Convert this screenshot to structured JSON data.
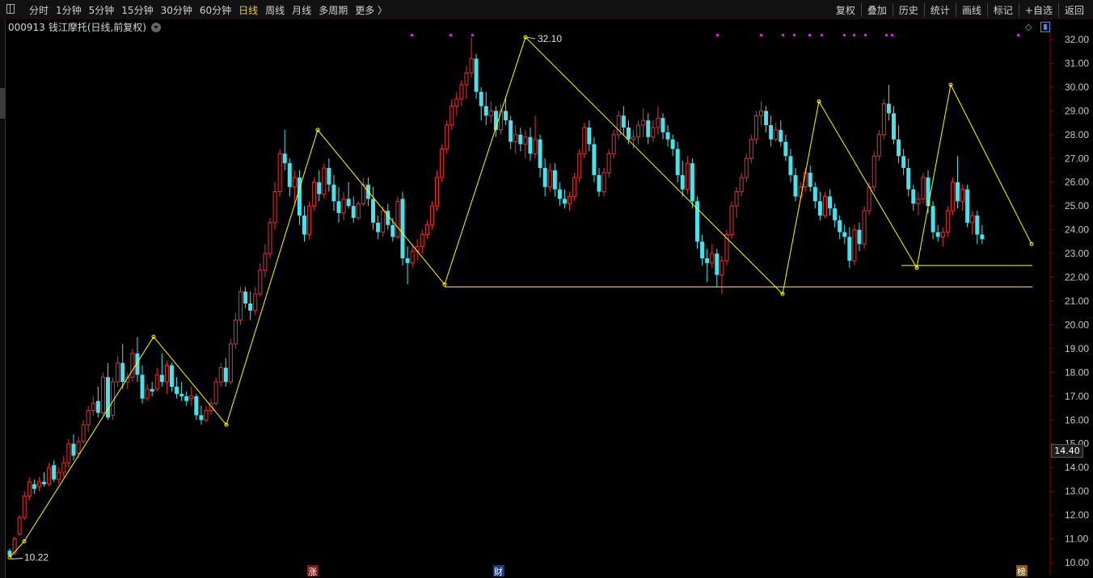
{
  "toolbar": {
    "tabs": [
      "分时",
      "1分钟",
      "5分钟",
      "15分钟",
      "30分钟",
      "60分钟",
      "日线",
      "周线",
      "月线",
      "多周期",
      "更多 〉"
    ],
    "active_tab": "日线",
    "tools": [
      "复权",
      "叠加",
      "历史",
      "统计",
      "画线",
      "标记",
      "+自选",
      "返回"
    ]
  },
  "header": {
    "code": "000913",
    "name": "钱江摩托(日线,前复权)",
    "corner_diamond": "◇"
  },
  "current_price": "14.40",
  "colors": {
    "up": "#e83232",
    "down": "#4ee0e8",
    "zigzag": "#ffff00",
    "axis_text": "#c8c8c8",
    "marker": "#e020e0",
    "bg": "#000000"
  },
  "chart_data": {
    "type": "candlestick",
    "title": "",
    "ylim": [
      9.6,
      32.4
    ],
    "y_ticks": [
      10,
      11,
      12,
      13,
      14,
      15,
      16,
      17,
      18,
      19,
      20,
      21,
      22,
      23,
      24,
      25,
      26,
      27,
      28,
      29,
      30,
      31,
      32
    ],
    "high_label": "32.10",
    "low_label": "10.22",
    "zigzag": [
      10.22,
      10.9,
      19.5,
      15.8,
      28.2,
      21.7,
      32.1,
      21.3,
      29.4,
      22.4,
      30.1,
      23.4
    ],
    "support_lines": [
      21.6,
      22.5
    ],
    "ohlc": [
      [
        10.5,
        10.6,
        10.22,
        10.3
      ],
      [
        10.4,
        11.1,
        10.3,
        11.0
      ],
      [
        11.2,
        12.0,
        11.1,
        11.9
      ],
      [
        11.9,
        13.0,
        11.8,
        12.8
      ],
      [
        12.8,
        13.6,
        12.6,
        13.4
      ],
      [
        13.3,
        13.5,
        12.9,
        13.1
      ],
      [
        13.2,
        13.6,
        13.0,
        13.4
      ],
      [
        13.4,
        13.8,
        13.2,
        13.3
      ],
      [
        13.3,
        14.2,
        13.2,
        14.0
      ],
      [
        14.1,
        14.3,
        13.4,
        13.5
      ],
      [
        13.5,
        14.0,
        13.3,
        13.8
      ],
      [
        13.8,
        14.5,
        13.6,
        14.2
      ],
      [
        14.2,
        15.2,
        14.0,
        15.0
      ],
      [
        15.0,
        15.4,
        14.3,
        14.5
      ],
      [
        14.6,
        15.3,
        14.4,
        15.1
      ],
      [
        15.1,
        16.0,
        15.0,
        15.8
      ],
      [
        15.8,
        16.6,
        15.5,
        16.4
      ],
      [
        16.4,
        17.0,
        16.2,
        16.7
      ],
      [
        16.8,
        17.4,
        16.1,
        16.3
      ],
      [
        16.3,
        18.0,
        16.2,
        17.8
      ],
      [
        17.8,
        18.4,
        16.0,
        16.1
      ],
      [
        16.2,
        17.8,
        16.0,
        17.6
      ],
      [
        17.6,
        18.7,
        17.4,
        18.4
      ],
      [
        18.4,
        19.2,
        17.3,
        17.6
      ],
      [
        17.6,
        18.0,
        17.3,
        17.8
      ],
      [
        17.8,
        19.0,
        17.6,
        18.8
      ],
      [
        18.8,
        19.5,
        17.6,
        17.9
      ],
      [
        17.9,
        18.3,
        16.7,
        16.9
      ],
      [
        16.9,
        17.5,
        16.8,
        17.3
      ],
      [
        17.3,
        17.6,
        17.0,
        17.2
      ],
      [
        17.3,
        18.2,
        17.2,
        17.9
      ],
      [
        17.9,
        18.8,
        17.4,
        17.6
      ],
      [
        17.6,
        18.5,
        17.1,
        18.3
      ],
      [
        18.3,
        18.4,
        17.2,
        17.4
      ],
      [
        17.4,
        17.8,
        16.9,
        17.1
      ],
      [
        17.1,
        17.6,
        16.8,
        17.0
      ],
      [
        17.0,
        17.2,
        16.6,
        16.8
      ],
      [
        16.9,
        17.4,
        16.6,
        17.0
      ],
      [
        17.0,
        17.1,
        16.0,
        16.2
      ],
      [
        16.2,
        16.6,
        15.8,
        16.0
      ],
      [
        16.0,
        16.6,
        15.9,
        16.4
      ],
      [
        16.4,
        16.9,
        16.2,
        16.7
      ],
      [
        16.7,
        17.8,
        16.6,
        17.6
      ],
      [
        17.6,
        18.4,
        17.4,
        18.2
      ],
      [
        18.2,
        18.6,
        17.4,
        17.6
      ],
      [
        17.6,
        19.4,
        17.5,
        19.2
      ],
      [
        19.2,
        20.5,
        19.0,
        20.2
      ],
      [
        20.2,
        21.6,
        20.0,
        21.4
      ],
      [
        21.4,
        21.6,
        20.7,
        20.9
      ],
      [
        20.9,
        21.4,
        20.2,
        20.6
      ],
      [
        20.6,
        21.6,
        20.4,
        21.3
      ],
      [
        21.3,
        22.6,
        21.2,
        22.3
      ],
      [
        22.3,
        23.4,
        22.0,
        23.0
      ],
      [
        23.0,
        24.5,
        22.8,
        24.3
      ],
      [
        24.3,
        26.0,
        24.0,
        25.6
      ],
      [
        25.6,
        27.4,
        25.4,
        27.2
      ],
      [
        27.2,
        28.2,
        26.5,
        26.8
      ],
      [
        26.8,
        27.0,
        25.4,
        25.8
      ],
      [
        25.8,
        26.5,
        25.0,
        26.2
      ],
      [
        26.2,
        26.5,
        24.2,
        24.6
      ],
      [
        24.6,
        25.0,
        23.5,
        23.8
      ],
      [
        23.8,
        25.2,
        23.6,
        25.0
      ],
      [
        25.0,
        26.2,
        24.8,
        26.0
      ],
      [
        26.0,
        26.5,
        25.2,
        25.5
      ],
      [
        25.5,
        26.8,
        25.3,
        26.6
      ],
      [
        26.6,
        27.0,
        25.6,
        25.9
      ],
      [
        25.9,
        26.3,
        24.8,
        25.2
      ],
      [
        25.2,
        25.8,
        24.3,
        24.7
      ],
      [
        24.7,
        25.6,
        24.4,
        25.3
      ],
      [
        25.3,
        26.0,
        24.9,
        25.0
      ],
      [
        25.0,
        25.4,
        24.3,
        24.5
      ],
      [
        24.5,
        25.2,
        24.4,
        25.1
      ],
      [
        25.1,
        26.2,
        25.0,
        25.9
      ],
      [
        25.9,
        26.2,
        25.0,
        25.3
      ],
      [
        25.3,
        25.8,
        24.0,
        24.3
      ],
      [
        24.3,
        24.6,
        23.6,
        23.9
      ],
      [
        23.9,
        25.0,
        23.7,
        24.8
      ],
      [
        24.8,
        25.1,
        24.0,
        24.2
      ],
      [
        24.2,
        24.5,
        23.5,
        23.7
      ],
      [
        23.7,
        25.4,
        23.6,
        25.2
      ],
      [
        25.3,
        25.6,
        22.5,
        22.8
      ],
      [
        22.8,
        23.3,
        21.7,
        22.6
      ],
      [
        22.6,
        23.4,
        22.4,
        23.1
      ],
      [
        23.1,
        23.6,
        22.7,
        23.3
      ],
      [
        23.3,
        24.0,
        23.0,
        23.8
      ],
      [
        23.8,
        24.4,
        23.6,
        24.2
      ],
      [
        24.2,
        25.2,
        24.0,
        25.0
      ],
      [
        25.0,
        26.5,
        24.8,
        26.2
      ],
      [
        26.2,
        27.6,
        26.0,
        27.4
      ],
      [
        27.4,
        28.6,
        27.2,
        28.4
      ],
      [
        28.4,
        29.5,
        28.2,
        29.2
      ],
      [
        29.2,
        29.8,
        28.8,
        29.5
      ],
      [
        29.5,
        30.3,
        29.2,
        30.1
      ],
      [
        30.1,
        30.9,
        29.5,
        30.6
      ],
      [
        30.6,
        32.1,
        30.4,
        31.2
      ],
      [
        31.2,
        31.4,
        29.5,
        29.8
      ],
      [
        29.8,
        30.0,
        28.6,
        29.2
      ],
      [
        29.2,
        29.8,
        28.4,
        28.8
      ],
      [
        28.8,
        29.4,
        28.5,
        29.0
      ],
      [
        29.0,
        29.2,
        27.9,
        28.2
      ],
      [
        28.2,
        29.3,
        28.0,
        29.0
      ],
      [
        29.0,
        29.6,
        28.4,
        28.6
      ],
      [
        28.6,
        28.8,
        27.4,
        27.7
      ],
      [
        27.7,
        28.4,
        27.2,
        28.0
      ],
      [
        28.0,
        28.3,
        27.3,
        27.6
      ],
      [
        27.6,
        28.2,
        27.0,
        27.9
      ],
      [
        27.9,
        28.3,
        26.9,
        27.2
      ],
      [
        27.2,
        28.8,
        27.0,
        27.8
      ],
      [
        27.8,
        28.0,
        26.2,
        26.6
      ],
      [
        26.6,
        27.0,
        25.4,
        25.8
      ],
      [
        25.8,
        26.8,
        25.6,
        26.5
      ],
      [
        26.5,
        26.8,
        25.4,
        25.7
      ],
      [
        25.7,
        26.0,
        25.0,
        25.3
      ],
      [
        25.3,
        25.7,
        24.9,
        25.1
      ],
      [
        25.1,
        25.6,
        24.8,
        25.4
      ],
      [
        25.4,
        26.4,
        25.2,
        26.2
      ],
      [
        26.2,
        27.4,
        26.0,
        27.2
      ],
      [
        27.2,
        28.5,
        27.0,
        28.3
      ],
      [
        28.3,
        28.6,
        27.3,
        27.6
      ],
      [
        27.6,
        27.9,
        26.0,
        26.3
      ],
      [
        26.3,
        26.6,
        25.4,
        25.6
      ],
      [
        25.6,
        26.6,
        25.4,
        26.4
      ],
      [
        26.4,
        27.4,
        26.2,
        27.2
      ],
      [
        27.2,
        28.2,
        27.0,
        28.0
      ],
      [
        28.0,
        29.0,
        27.8,
        28.8
      ],
      [
        28.8,
        29.2,
        28.0,
        28.3
      ],
      [
        28.3,
        28.6,
        27.6,
        27.8
      ],
      [
        27.8,
        28.2,
        27.4,
        27.9
      ],
      [
        27.9,
        28.6,
        27.6,
        28.4
      ],
      [
        28.4,
        29.1,
        27.9,
        28.6
      ],
      [
        28.6,
        28.9,
        27.6,
        27.9
      ],
      [
        27.9,
        28.6,
        27.7,
        28.3
      ],
      [
        28.3,
        29.2,
        28.0,
        28.7
      ],
      [
        28.7,
        28.9,
        27.8,
        28.1
      ],
      [
        28.1,
        28.4,
        27.5,
        27.8
      ],
      [
        27.8,
        28.0,
        27.1,
        27.4
      ],
      [
        27.4,
        27.7,
        26.0,
        26.3
      ],
      [
        26.3,
        26.9,
        25.4,
        25.7
      ],
      [
        25.7,
        27.1,
        25.5,
        26.8
      ],
      [
        26.8,
        27.0,
        24.9,
        25.2
      ],
      [
        25.2,
        25.4,
        23.2,
        23.5
      ],
      [
        23.5,
        23.8,
        22.5,
        22.8
      ],
      [
        22.8,
        23.2,
        21.8,
        22.6
      ],
      [
        22.6,
        23.4,
        22.4,
        23.0
      ],
      [
        23.0,
        23.2,
        21.6,
        22.1
      ],
      [
        22.1,
        22.9,
        21.3,
        22.7
      ],
      [
        22.7,
        24.0,
        22.5,
        23.8
      ],
      [
        23.8,
        25.2,
        23.6,
        25.0
      ],
      [
        25.0,
        25.8,
        24.5,
        25.6
      ],
      [
        25.6,
        26.4,
        25.4,
        26.2
      ],
      [
        26.2,
        27.2,
        26.0,
        27.0
      ],
      [
        27.0,
        28.0,
        26.8,
        27.8
      ],
      [
        27.8,
        29.0,
        27.6,
        28.8
      ],
      [
        28.8,
        29.4,
        28.4,
        29.0
      ],
      [
        29.0,
        29.2,
        28.1,
        28.4
      ],
      [
        28.4,
        28.8,
        27.5,
        27.8
      ],
      [
        27.8,
        28.5,
        27.7,
        28.2
      ],
      [
        28.2,
        28.6,
        27.5,
        27.7
      ],
      [
        27.7,
        28.0,
        26.9,
        27.1
      ],
      [
        27.1,
        27.4,
        26.0,
        26.3
      ],
      [
        26.3,
        26.6,
        25.2,
        25.4
      ],
      [
        25.4,
        26.0,
        25.2,
        25.8
      ],
      [
        25.8,
        26.6,
        25.6,
        26.4
      ],
      [
        26.4,
        26.7,
        25.6,
        25.8
      ],
      [
        25.8,
        26.0,
        24.9,
        25.2
      ],
      [
        25.2,
        25.6,
        24.4,
        24.6
      ],
      [
        24.6,
        25.6,
        24.5,
        25.4
      ],
      [
        25.4,
        25.7,
        24.6,
        24.9
      ],
      [
        24.9,
        25.1,
        24.1,
        24.4
      ],
      [
        24.4,
        24.6,
        23.6,
        23.9
      ],
      [
        23.9,
        24.2,
        23.4,
        23.7
      ],
      [
        23.7,
        24.1,
        22.4,
        22.7
      ],
      [
        22.7,
        24.2,
        22.5,
        24.0
      ],
      [
        24.0,
        24.3,
        23.1,
        23.4
      ],
      [
        23.4,
        25.0,
        23.2,
        24.8
      ],
      [
        24.8,
        26.0,
        24.6,
        25.8
      ],
      [
        25.8,
        27.3,
        25.6,
        27.1
      ],
      [
        27.1,
        28.2,
        26.9,
        28.0
      ],
      [
        28.0,
        29.5,
        27.8,
        29.3
      ],
      [
        29.3,
        30.1,
        28.6,
        28.9
      ],
      [
        28.9,
        29.2,
        27.6,
        27.8
      ],
      [
        27.8,
        28.4,
        26.8,
        27.1
      ],
      [
        27.1,
        27.4,
        26.3,
        26.6
      ],
      [
        26.6,
        27.0,
        25.4,
        25.7
      ],
      [
        25.7,
        25.9,
        24.8,
        25.1
      ],
      [
        25.1,
        25.6,
        24.6,
        25.3
      ],
      [
        25.3,
        26.4,
        25.1,
        26.2
      ],
      [
        26.2,
        26.5,
        24.7,
        25.0
      ],
      [
        25.0,
        25.2,
        23.6,
        23.9
      ],
      [
        23.9,
        24.2,
        23.5,
        23.7
      ],
      [
        23.7,
        24.1,
        23.3,
        23.9
      ],
      [
        23.9,
        25.0,
        23.7,
        24.8
      ],
      [
        24.8,
        26.2,
        24.6,
        26.0
      ],
      [
        26.0,
        27.1,
        24.9,
        25.2
      ],
      [
        25.2,
        25.9,
        24.8,
        25.7
      ],
      [
        25.7,
        25.9,
        24.1,
        24.3
      ],
      [
        24.3,
        24.8,
        23.8,
        24.6
      ],
      [
        24.6,
        24.8,
        23.4,
        23.8
      ],
      [
        23.8,
        24.2,
        23.4,
        23.6
      ]
    ]
  },
  "markers": {
    "zhang": "涨",
    "cai": "财",
    "bang": "榜"
  }
}
